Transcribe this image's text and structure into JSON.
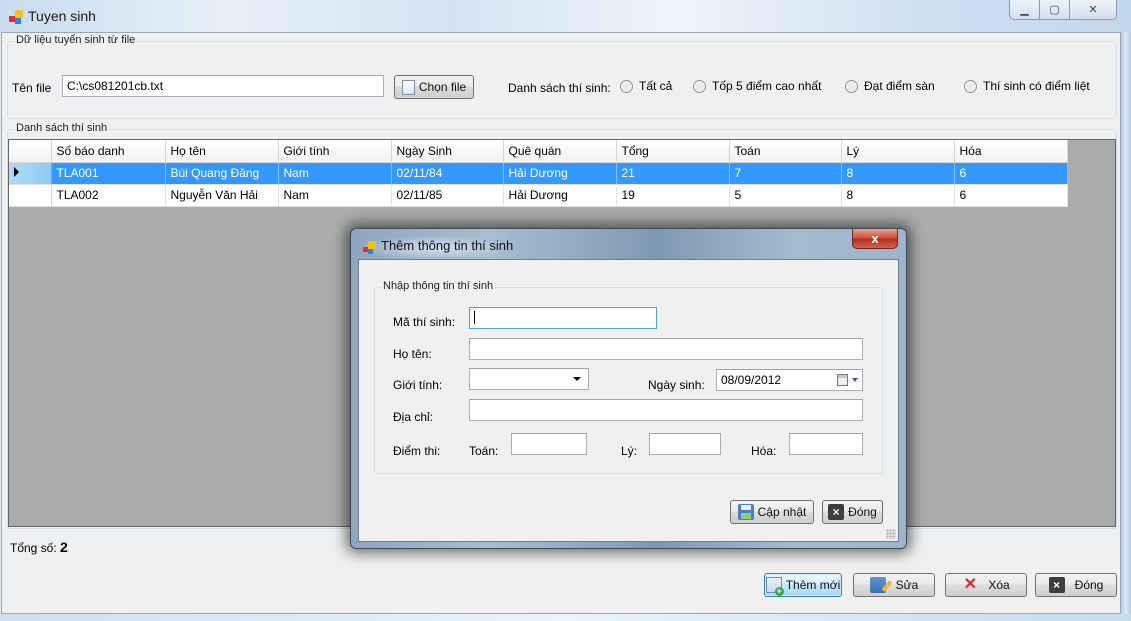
{
  "window": {
    "title": "Tuyen sinh",
    "controls": {
      "minimize": "minimize",
      "maximize": "maximize",
      "close": "close"
    }
  },
  "file_group": {
    "legend": "Dữ liệu tuyển sinh từ file",
    "file_label": "Tên file",
    "file_value": "C:\\cs081201cb.txt",
    "choose_button": "Chọn file",
    "filter_label": "Danh sách thí sinh:",
    "filters": [
      {
        "label": "Tất cả",
        "checked": false
      },
      {
        "label": "Tốp 5 điểm cao nhất",
        "checked": false
      },
      {
        "label": "Đạt điểm sàn",
        "checked": false
      },
      {
        "label": "Thí sinh có điểm liệt",
        "checked": false
      }
    ]
  },
  "list_group": {
    "legend": "Danh sách thí sinh",
    "columns": [
      "Số báo danh",
      "Họ tên",
      "Giới tính",
      "Ngày Sinh",
      "Quê quán",
      "Tổng",
      "Toán",
      "Lý",
      "Hóa"
    ],
    "rows": [
      {
        "selected": true,
        "cells": [
          "TLA001",
          "Bùi Quang Đăng",
          "Nam",
          "02/11/84",
          "Hải Dương",
          "21",
          "7",
          "8",
          "6"
        ]
      },
      {
        "selected": false,
        "cells": [
          "TLA002",
          "Nguyễn Văn Hải",
          "Nam",
          "02/11/85",
          "Hải Dương",
          "19",
          "5",
          "8",
          "6"
        ]
      }
    ]
  },
  "summary": {
    "total_label": "Tổng số:",
    "total_value": "2"
  },
  "actions": {
    "add": "Thêm mới",
    "edit": "Sửa",
    "delete": "Xóa",
    "close": "Đóng"
  },
  "dialog": {
    "title": "Thêm thông tin thí sinh",
    "close_glyph": "x",
    "group_legend": "Nhập thông tin thí sinh",
    "fields": {
      "student_id": {
        "label": "Mã thí sinh:",
        "value": ""
      },
      "full_name": {
        "label": "Họ tên:",
        "value": ""
      },
      "gender": {
        "label": "Giới tính:",
        "value": ""
      },
      "birth_date": {
        "label": "Ngày sinh:",
        "value": "08/09/2012"
      },
      "address": {
        "label": "Địa chỉ:",
        "value": ""
      },
      "scores_label": "Điểm thi:",
      "math": {
        "label": "Toán:",
        "value": ""
      },
      "physics": {
        "label": "Lý:",
        "value": ""
      },
      "chemistry": {
        "label": "Hóa:",
        "value": ""
      }
    },
    "update_button": "Cập nhật",
    "close_button": "Đóng"
  }
}
